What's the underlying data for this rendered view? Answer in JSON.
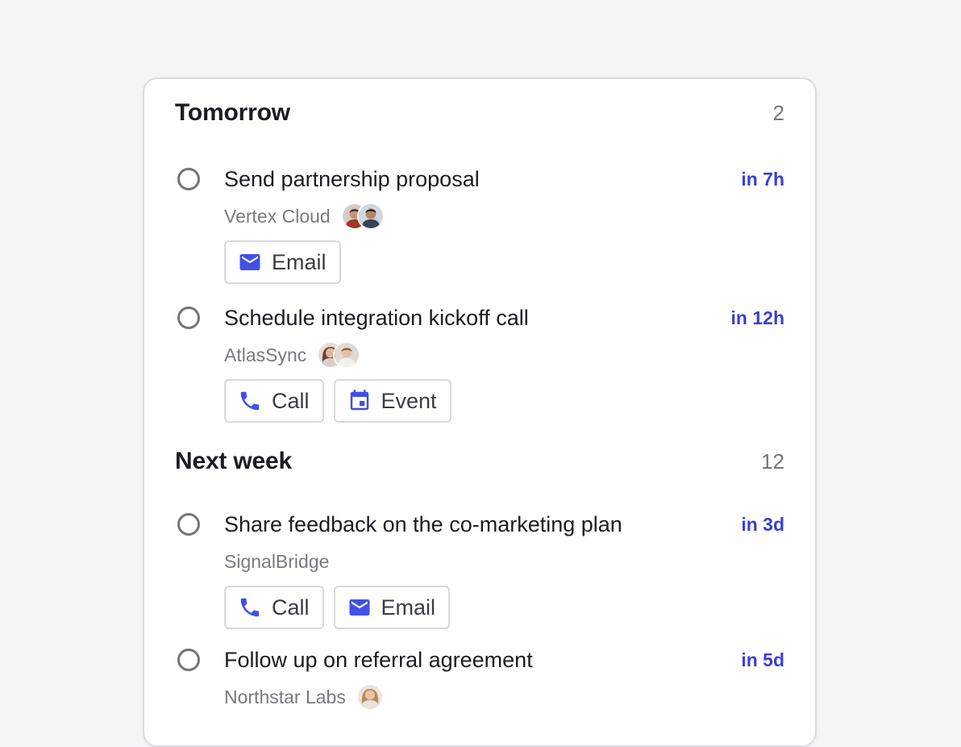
{
  "sections": [
    {
      "title": "Tomorrow",
      "count": "2",
      "tasks": [
        {
          "title": "Send partnership proposal",
          "company": "Vertex Cloud",
          "due": "in 7h",
          "actions": [
            {
              "label": "Email",
              "icon": "mail-icon"
            }
          ]
        },
        {
          "title": "Schedule integration kickoff call",
          "company": "AtlasSync",
          "due": "in 12h",
          "actions": [
            {
              "label": "Call",
              "icon": "phone-icon"
            },
            {
              "label": "Event",
              "icon": "calendar-icon"
            }
          ]
        }
      ]
    },
    {
      "title": "Next week",
      "count": "12",
      "tasks": [
        {
          "title": "Share feedback on the co-marketing plan",
          "company": "SignalBridge",
          "due": "in 3d",
          "actions": [
            {
              "label": "Call",
              "icon": "phone-icon"
            },
            {
              "label": "Email",
              "icon": "mail-icon"
            }
          ]
        },
        {
          "title": "Follow up on referral agreement",
          "company": "Northstar Labs",
          "due": "in 5d"
        }
      ]
    }
  ],
  "colors": {
    "accent": "#3a40d0",
    "icon": "#4350e6",
    "background": "#f5f4f8",
    "card": "#ffffff"
  }
}
